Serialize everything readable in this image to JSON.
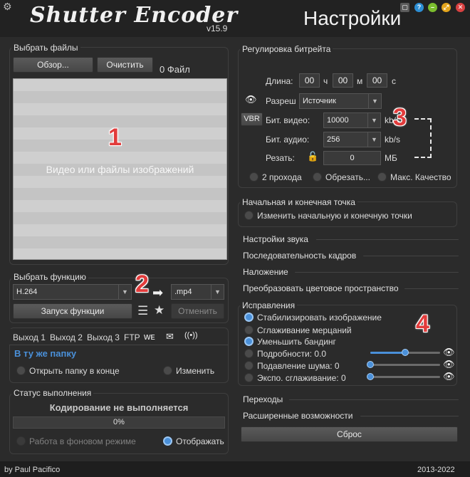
{
  "app": {
    "logo": "Shutter Encoder",
    "version": "v15.9",
    "settings_title": "Настройки",
    "footer_author": "by Paul Pacifico",
    "footer_years": "2013-2022"
  },
  "files": {
    "title": "Выбрать файлы",
    "browse": "Обзор...",
    "clear": "Очистить",
    "count": "0 Файл",
    "drop_text": "Видео или файлы изображений"
  },
  "function": {
    "title": "Выбрать функцию",
    "selected": "H.264",
    "extension": ".mp4",
    "run": "Запуск функции",
    "cancel": "Отменить"
  },
  "output": {
    "tabs": [
      "Выход 1",
      "Выход 2",
      "Выход 3",
      "FTP"
    ],
    "same_folder": "В ту же папку",
    "open_folder": "Открыть папку в конце",
    "change": "Изменить"
  },
  "status": {
    "title": "Статус выполнения",
    "message": "Кодирование не выполняется",
    "progress_text": "0%",
    "progress": 0,
    "background": "Работа в фоновом режиме",
    "display": "Отображать"
  },
  "bitrate": {
    "title": "Регулировка битрейта",
    "length_label": "Длина:",
    "h": "00",
    "h_unit": "ч",
    "m": "00",
    "m_unit": "м",
    "s": "00",
    "s_unit": "с",
    "resolution_label": "Разреш",
    "resolution_value": "Источник",
    "vbr": "VBR",
    "video_label": "Бит. видео:",
    "video_value": "10000",
    "video_unit": "kb/s",
    "audio_label": "Бит. аудио:",
    "audio_value": "256",
    "audio_unit": "kb/s",
    "cut_label": "Резать:",
    "cut_value": "0",
    "cut_unit": "МБ",
    "two_pass": "2 прохода",
    "trim": "Обрезать...",
    "max_quality": "Макс. Качество"
  },
  "inout": {
    "title": "Начальная и конечная точка",
    "option": "Изменить начальную и конечную точки"
  },
  "sections": {
    "audio": "Настройки звука",
    "sequence": "Последовательность кадров",
    "overlay": "Наложение",
    "colorspace": "Преобразовать цветовое пространство",
    "transitions": "Переходы",
    "advanced": "Расширенные возможности"
  },
  "corrections": {
    "title": "Исправления",
    "stabilize": "Стабилизировать изображение",
    "deflicker": "Сглаживание мерцаний",
    "debanding": "Уменьшить бандинг",
    "details": "Подробности: 0.0",
    "details_level": 0.5,
    "denoise": "Подавление шума: 0",
    "denoise_level": 0,
    "exposure": "Экспо. сглаживание: 0",
    "exposure_level": 0
  },
  "reset": "Сброс",
  "annotations": {
    "n1": "1",
    "n2": "2",
    "n3": "3",
    "n4": "4"
  },
  "colors": {
    "accent": "#4a90d9",
    "annotation": "#e23c3c"
  }
}
